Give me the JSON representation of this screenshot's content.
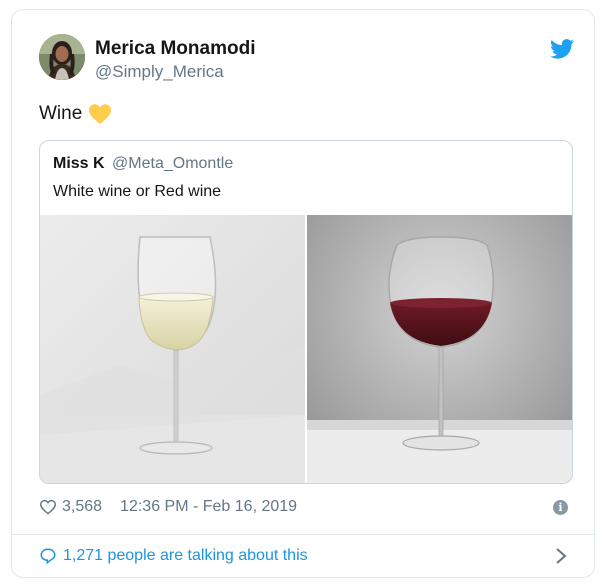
{
  "tweet": {
    "author_name": "Merica Monamodi",
    "author_handle": "@Simply_Merica",
    "text": "Wine",
    "emoji": "yellow-heart-icon",
    "likes": "3,568",
    "timestamp": "12:36 PM - Feb 16, 2019",
    "talking": "1,271 people are talking about this"
  },
  "quote": {
    "author_name": "Miss K",
    "author_handle": "@Meta_Omontle",
    "text": "White wine or Red wine"
  },
  "colors": {
    "accent": "#1da1f2",
    "link": "#1b95e0",
    "muted": "#657786",
    "border": "#e1e8ed",
    "heart": "#ffcc4d"
  }
}
